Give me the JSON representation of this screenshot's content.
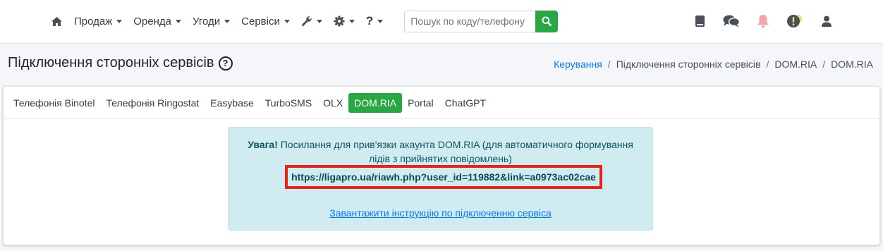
{
  "topnav": {
    "home_icon": "home-icon",
    "menu": [
      {
        "label": "Продаж"
      },
      {
        "label": "Оренда"
      },
      {
        "label": "Угоди"
      },
      {
        "label": "Сервіси"
      }
    ],
    "tools_icon": "wrench-icon",
    "settings_icon": "gear-icon",
    "help_label": "?",
    "search": {
      "placeholder": "Пошук по коду/телефону",
      "value": ""
    },
    "right_icons": [
      "book-icon",
      "chat-icon",
      "bell-icon",
      "warning-icon",
      "user-icon"
    ]
  },
  "header": {
    "title": "Підключення сторонніх сервісів",
    "help_icon_label": "?",
    "breadcrumb": [
      "Керування",
      "Підключення сторонніх сервісів",
      "DOM.RIA",
      "DOM.RIA"
    ]
  },
  "tabs": [
    {
      "label": "Телефонія Binotel",
      "active": false
    },
    {
      "label": "Телефонія Ringostat",
      "active": false
    },
    {
      "label": "Easybase",
      "active": false
    },
    {
      "label": "TurboSMS",
      "active": false
    },
    {
      "label": "OLX",
      "active": false
    },
    {
      "label": "DOM.RIA",
      "active": true
    },
    {
      "label": "Portal",
      "active": false
    },
    {
      "label": "ChatGPT",
      "active": false
    }
  ],
  "alert": {
    "strong": "Увага!",
    "message": " Посилання для прив'язки акаунта DOM.RIA (для автоматичного формування лідів з прийнятих повідомлень)",
    "link": "https://ligapro.ua/riawh.php?user_id=119882&link=a0973ac02cae",
    "download_label": "Завантажити інструкцію по підключенню сервіса"
  },
  "colors": {
    "accent_green": "#28a745",
    "alert_bg": "#d1ecf1",
    "highlight_red": "#e8241a",
    "link_blue": "#007bff"
  }
}
